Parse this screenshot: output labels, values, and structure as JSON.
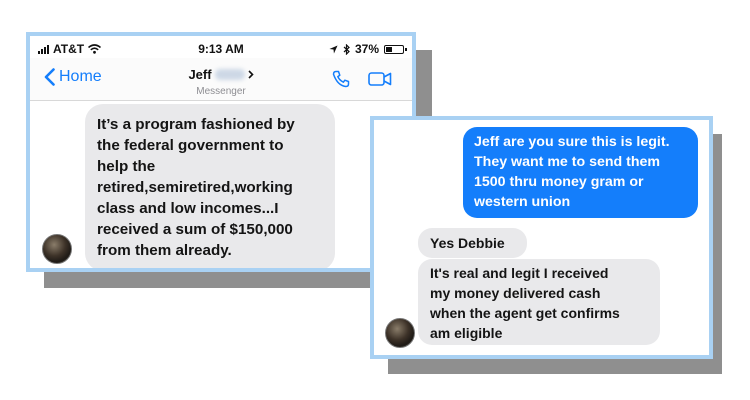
{
  "status_bar": {
    "carrier": "AT&T",
    "time": "9:13 AM",
    "battery": "37%",
    "battery_level": 0.37
  },
  "nav": {
    "back_label": "Home",
    "contact_name": "Jeff",
    "app_label": "Messenger"
  },
  "left_message": {
    "text": "It’s a program fashioned by\nthe federal government to\nhelp the\nretired,semiretired,working\nclass and low incomes...I\nreceived a sum of $150,000\nfrom them already."
  },
  "right_messages": {
    "outgoing": "Jeff are you sure this is legit.\nThey want me to send them\n1500 thru money gram or\nwestern union",
    "incoming_1": "Yes Debbie",
    "incoming_2": "It's real and legit I received\nmy money delivered cash\nwhen the agent get confirms\nam eligible"
  },
  "colors": {
    "accent": "#147efb",
    "incoming_bubble": "#e9e9eb",
    "card_border": "#a9d1f3",
    "shadow": "#8f8f8f"
  },
  "icons": [
    "signal-bars-icon",
    "wifi-icon",
    "location-arrow-icon",
    "bluetooth-icon",
    "battery-icon",
    "back-chevron-icon",
    "chevron-right-icon",
    "phone-icon",
    "video-camera-icon"
  ]
}
